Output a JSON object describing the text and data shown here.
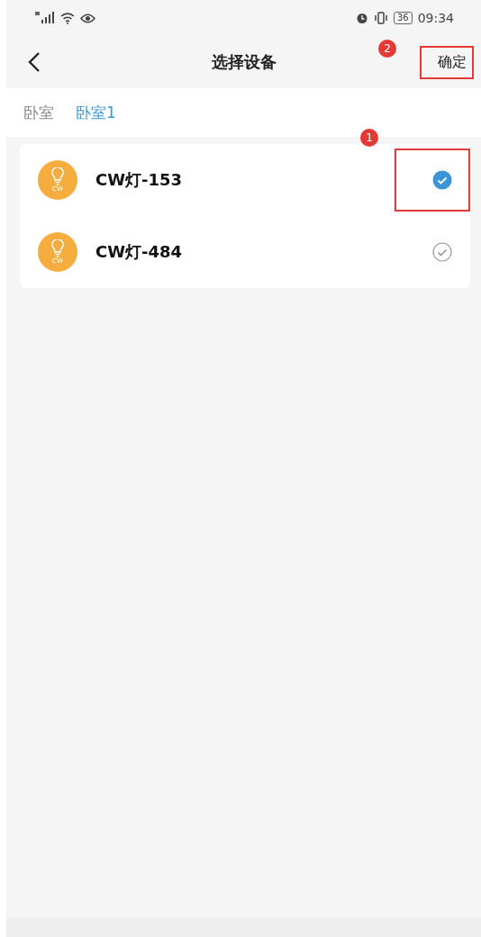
{
  "status_bar": {
    "battery": "36",
    "time": "09:34"
  },
  "header": {
    "title": "选择设备",
    "confirm": {
      "label": "确定",
      "annotation": "2"
    }
  },
  "tabs": [
    {
      "label": "卧室",
      "selected": false
    },
    {
      "label": "卧室1",
      "selected": true
    }
  ],
  "devices": [
    {
      "name": "CW灯-153",
      "icon_label": "CW",
      "selected": true,
      "annotation": "1"
    },
    {
      "name": "CW灯-484",
      "icon_label": "CW",
      "selected": false
    }
  ]
}
